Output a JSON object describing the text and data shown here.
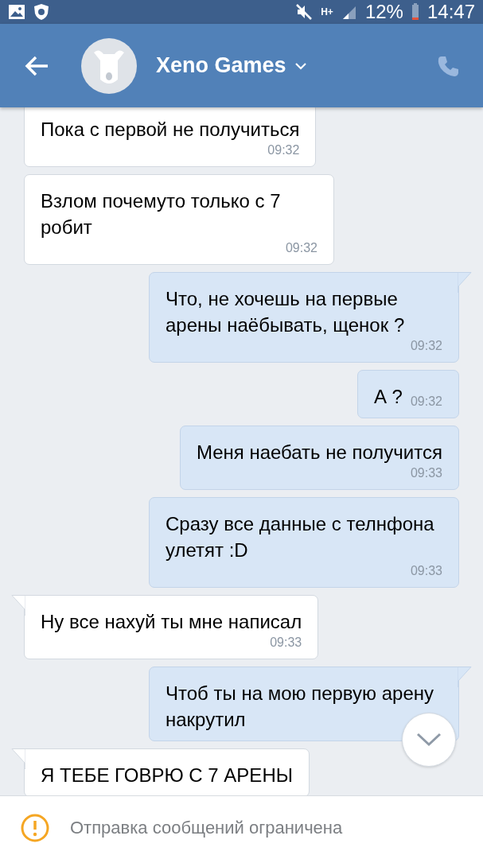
{
  "status_bar": {
    "battery": "12%",
    "time": "14:47",
    "network": "H+"
  },
  "header": {
    "title": "Xeno Games"
  },
  "messages": [
    {
      "kind": "incoming",
      "text": "Пока с первой не получиться",
      "time": "09:32",
      "tail": false
    },
    {
      "kind": "incoming",
      "text": "Взлом почемуто только с 7 робит",
      "time": "09:32",
      "tail": false
    },
    {
      "kind": "outgoing",
      "text": "Что, не хочешь на первые арены наёбывать, щенок ?",
      "time": "09:32",
      "tail": true
    },
    {
      "kind": "outgoing",
      "text": "А ?",
      "time": "09:32",
      "tail": false,
      "inline_time": true
    },
    {
      "kind": "outgoing",
      "text": "Меня наебать не получится",
      "time": "09:33",
      "tail": false
    },
    {
      "kind": "outgoing",
      "text": "Сразу все данные с телнфона улетят :D",
      "time": "09:33",
      "tail": false
    },
    {
      "kind": "incoming",
      "text": "Ну все нахуй ты мне написал",
      "time": "09:33",
      "tail": true
    },
    {
      "kind": "outgoing",
      "text": "Чтоб ты на мою первую арену накрутил",
      "tail": true
    },
    {
      "kind": "incoming",
      "text": "Я ТЕБЕ ГОВРЮ С 7 АРЕНЫ",
      "tail": true
    }
  ],
  "notice": {
    "text": "Отправка сообщений ограничена"
  }
}
